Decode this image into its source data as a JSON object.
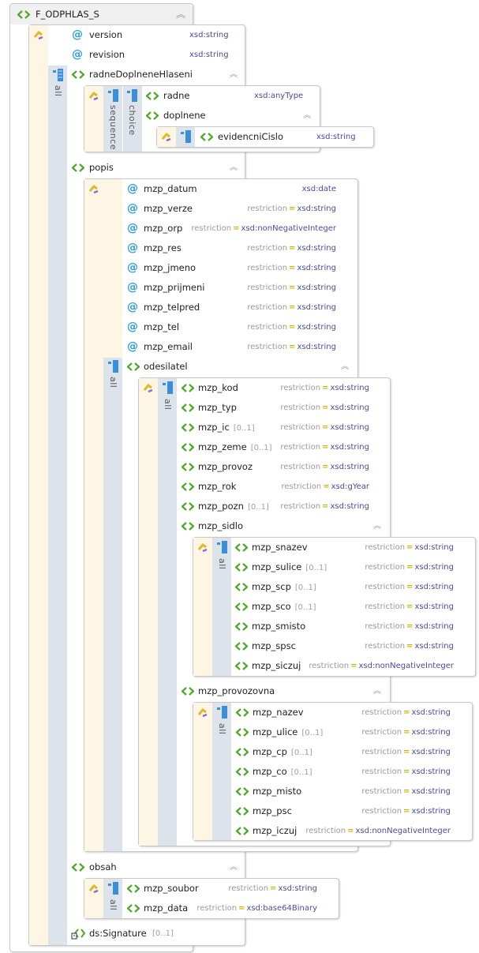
{
  "root": {
    "name": "F_ODPHLAS_S"
  },
  "root_children": {
    "attributes": [
      {
        "name": "version",
        "type": "xsd:string"
      },
      {
        "name": "revision",
        "type": "xsd:string"
      }
    ],
    "compositor": "all",
    "radne": {
      "name": "radneDoplneneHlaseni",
      "compositors": [
        "sequence",
        "choice"
      ],
      "children": [
        {
          "name": "radne",
          "type": "xsd:anyType"
        },
        {
          "name": "doplnene"
        }
      ],
      "doplnene_child": {
        "name": "evidencniCislo",
        "type": "xsd:string"
      }
    },
    "popis": {
      "name": "popis",
      "attributes": [
        {
          "name": "mzp_datum",
          "restriction": "",
          "type": "xsd:date"
        },
        {
          "name": "mzp_verze",
          "restriction": "restriction",
          "type": "xsd:string"
        },
        {
          "name": "mzp_orp",
          "restriction": "restriction",
          "type": "xsd:nonNegativeInteger"
        },
        {
          "name": "mzp_res",
          "restriction": "restriction",
          "type": "xsd:string"
        },
        {
          "name": "mzp_jmeno",
          "restriction": "restriction",
          "type": "xsd:string"
        },
        {
          "name": "mzp_prijmeni",
          "restriction": "restriction",
          "type": "xsd:string"
        },
        {
          "name": "mzp_telpred",
          "restriction": "restriction",
          "type": "xsd:string"
        },
        {
          "name": "mzp_tel",
          "restriction": "restriction",
          "type": "xsd:string"
        },
        {
          "name": "mzp_email",
          "restriction": "restriction",
          "type": "xsd:string"
        }
      ],
      "compositor": "all",
      "odesilatel": {
        "name": "odesilatel",
        "compositor": "all",
        "elements": [
          {
            "name": "mzp_kod",
            "card": "",
            "restriction": "restriction",
            "type": "xsd:string"
          },
          {
            "name": "mzp_typ",
            "card": "",
            "restriction": "restriction",
            "type": "xsd:string"
          },
          {
            "name": "mzp_ic",
            "card": "[0..1]",
            "restriction": "restriction",
            "type": "xsd:string"
          },
          {
            "name": "mzp_zeme",
            "card": "[0..1]",
            "restriction": "restriction",
            "type": "xsd:string"
          },
          {
            "name": "mzp_provoz",
            "card": "",
            "restriction": "restriction",
            "type": "xsd:string"
          },
          {
            "name": "mzp_rok",
            "card": "",
            "restriction": "restriction",
            "type": "xsd:gYear"
          },
          {
            "name": "mzp_pozn",
            "card": "[0..1]",
            "restriction": "restriction",
            "type": "xsd:string"
          }
        ],
        "sidlo": {
          "name": "mzp_sidlo",
          "compositor": "all",
          "elements": [
            {
              "name": "mzp_snazev",
              "card": "",
              "restriction": "restriction",
              "type": "xsd:string"
            },
            {
              "name": "mzp_sulice",
              "card": "[0..1]",
              "restriction": "restriction",
              "type": "xsd:string"
            },
            {
              "name": "mzp_scp",
              "card": "[0..1]",
              "restriction": "restriction",
              "type": "xsd:string"
            },
            {
              "name": "mzp_sco",
              "card": "[0..1]",
              "restriction": "restriction",
              "type": "xsd:string"
            },
            {
              "name": "mzp_smisto",
              "card": "",
              "restriction": "restriction",
              "type": "xsd:string"
            },
            {
              "name": "mzp_spsc",
              "card": "",
              "restriction": "restriction",
              "type": "xsd:string"
            },
            {
              "name": "mzp_siczuj",
              "card": "",
              "restriction": "restriction",
              "type": "xsd:nonNegativeInteger"
            }
          ]
        },
        "provozovna": {
          "name": "mzp_provozovna",
          "compositor": "all",
          "elements": [
            {
              "name": "mzp_nazev",
              "card": "",
              "restriction": "restriction",
              "type": "xsd:string"
            },
            {
              "name": "mzp_ulice",
              "card": "[0..1]",
              "restriction": "restriction",
              "type": "xsd:string"
            },
            {
              "name": "mzp_cp",
              "card": "[0..1]",
              "restriction": "restriction",
              "type": "xsd:string"
            },
            {
              "name": "mzp_co",
              "card": "[0..1]",
              "restriction": "restriction",
              "type": "xsd:string"
            },
            {
              "name": "mzp_misto",
              "card": "",
              "restriction": "restriction",
              "type": "xsd:string"
            },
            {
              "name": "mzp_psc",
              "card": "",
              "restriction": "restriction",
              "type": "xsd:string"
            },
            {
              "name": "mzp_iczuj",
              "card": "",
              "restriction": "restriction",
              "type": "xsd:nonNegativeInteger"
            }
          ]
        }
      }
    },
    "obsah": {
      "name": "obsah",
      "compositor": "all",
      "elements": [
        {
          "name": "mzp_soubor",
          "restriction": "restriction",
          "type": "xsd:string"
        },
        {
          "name": "mzp_data",
          "restriction": "restriction",
          "type": "xsd:base64Binary"
        }
      ]
    },
    "signature": {
      "name": "ds:Signature",
      "card": "[0..1]"
    }
  },
  "symbols": {
    "eq": "=",
    "collapse": "≈"
  },
  "colors": {
    "attribute": "#2ea0dc",
    "element": "#4ea82a",
    "type": "#4b4ba0",
    "restriction": "#9a9a9a",
    "equals": "#c8b400",
    "beige": "#fdf6e4",
    "compositor_bg": "#dde3ea"
  }
}
